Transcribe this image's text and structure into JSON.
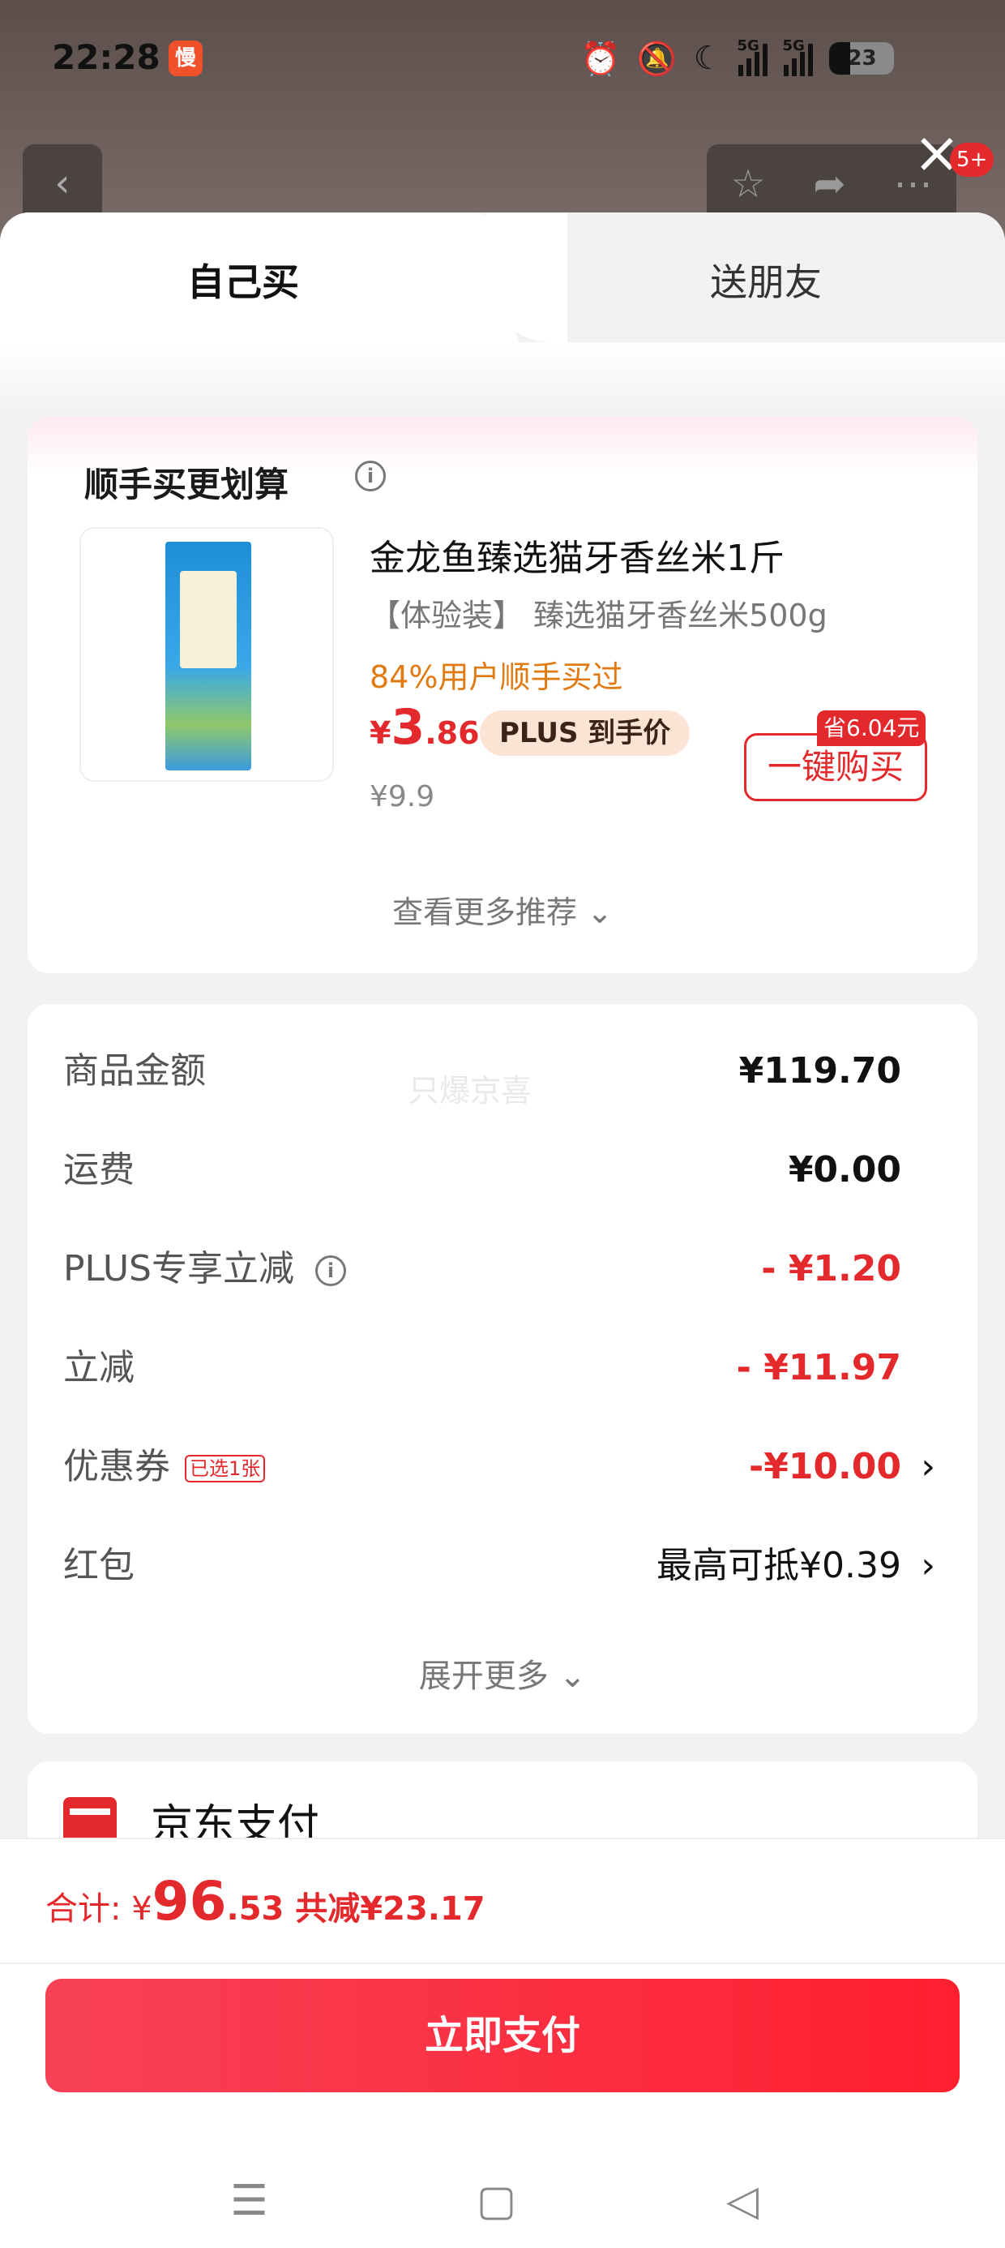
{
  "status": {
    "time": "22:28",
    "app_badge": "慢",
    "network1": "5G",
    "network2": "5G",
    "battery": "23"
  },
  "topbar": {
    "notification_count": "5+"
  },
  "tabs": {
    "self": "自己买",
    "gift": "送朋友"
  },
  "recommend": {
    "title": "顺手买更划算",
    "product_name": "金龙鱼臻选猫牙香丝米1斤",
    "product_spec": "【体验装】 臻选猫牙香丝米500g",
    "ratio_text": "84%用户顺手买过",
    "price_currency": "¥",
    "price_int": "3",
    "price_dec": ".86",
    "plus_tag": "PLUS 到手价",
    "original_price": "¥9.9",
    "save_tag": "省6.04元",
    "buy_button": "一键购买",
    "more_label": "查看更多推荐 ⌄"
  },
  "costs": {
    "watermark": "只爆京喜",
    "rows": [
      {
        "label": "商品金额",
        "value": "¥119.70"
      },
      {
        "label": "运费",
        "value": "¥0.00"
      },
      {
        "label": "PLUS专享立减",
        "value": "- ¥1.20"
      },
      {
        "label": "立减",
        "value": "- ¥11.97"
      },
      {
        "label": "优惠券",
        "tag": "已选1张",
        "value": "-¥10.00"
      },
      {
        "label": "红包",
        "value": "最高可抵¥0.39"
      }
    ],
    "expand_label": "展开更多 ⌄"
  },
  "payment": {
    "method": "京东支付"
  },
  "footer": {
    "total_label": "合计: ¥",
    "total_int": "96",
    "total_dec": ".53",
    "reduced": " 共减¥23.17",
    "pay_button": "立即支付"
  },
  "colors": {
    "accent": "#e4292d",
    "highlight": "#e07a12"
  }
}
